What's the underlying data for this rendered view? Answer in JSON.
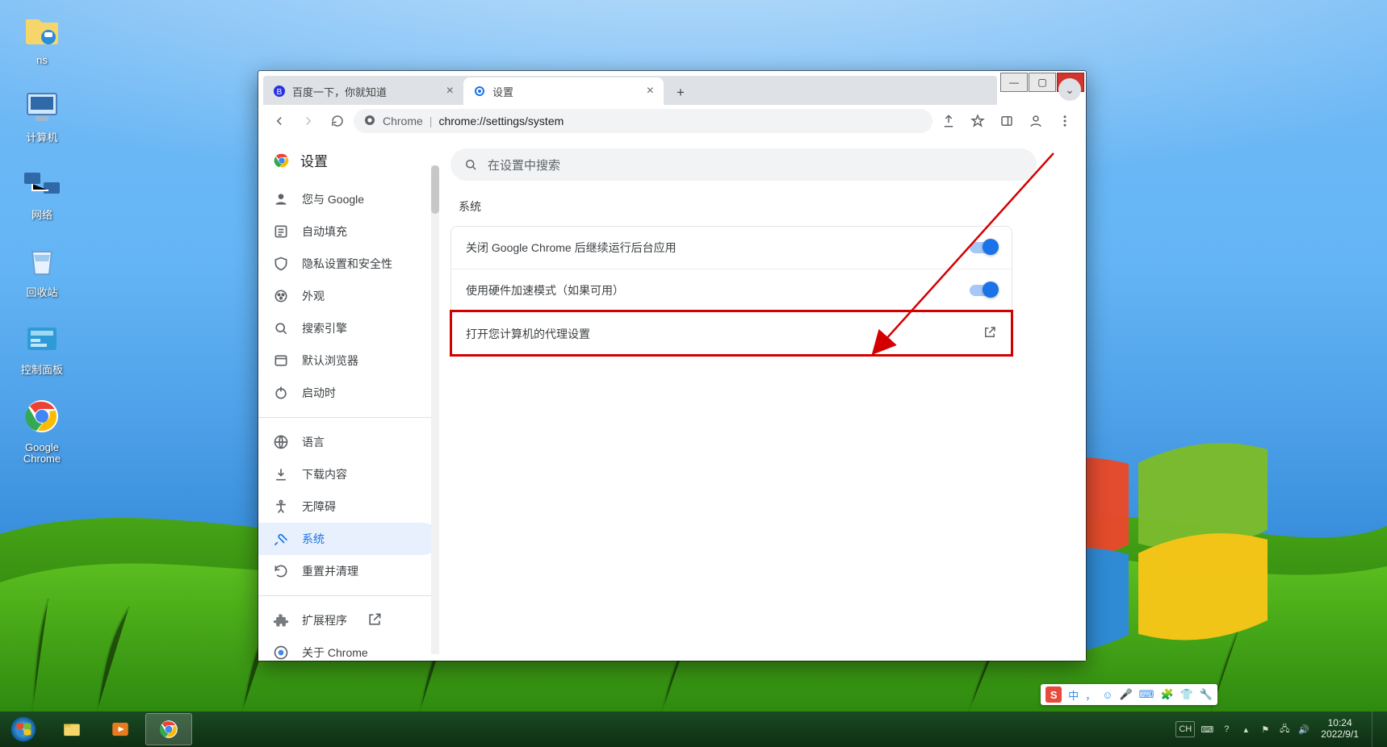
{
  "desktop_icons": {
    "ns": "ns",
    "computer": "计算机",
    "network": "网络",
    "recycle": "回收站",
    "ctrlpanel": "控制面板",
    "gchrome": "Google\nChrome"
  },
  "ime": {
    "s": "S",
    "lang": "中"
  },
  "tray": {
    "lang": "CH"
  },
  "clock": {
    "time": "10:24",
    "date": "2022/9/1"
  },
  "tabs": {
    "baidu": "百度一下，你就知道",
    "settings": "设置"
  },
  "omnibox": {
    "origin": "Chrome",
    "path": "chrome://settings/system"
  },
  "settings": {
    "app_title": "设置",
    "search_placeholder": "在设置中搜索",
    "nav": {
      "you": "您与 Google",
      "autofill": "自动填充",
      "privacy": "隐私设置和安全性",
      "appearance": "外观",
      "search_engine": "搜索引擎",
      "default_browser": "默认浏览器",
      "on_startup": "启动时",
      "languages": "语言",
      "downloads": "下载内容",
      "accessibility": "无障碍",
      "system": "系统",
      "reset": "重置并清理",
      "extensions": "扩展程序",
      "about": "关于 Chrome"
    },
    "section_title": "系统",
    "rows": {
      "bg": "关闭 Google Chrome 后继续运行后台应用",
      "hw": "使用硬件加速模式（如果可用）",
      "proxy": "打开您计算机的代理设置"
    }
  }
}
